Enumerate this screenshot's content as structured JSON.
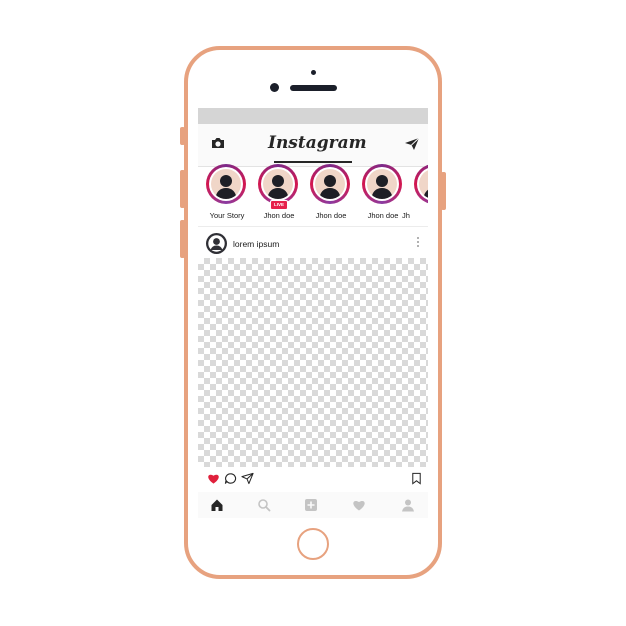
{
  "app": {
    "title": "Instagram"
  },
  "stories": [
    {
      "name": "Your Story",
      "live": false
    },
    {
      "name": "Jhon doe",
      "live": true,
      "badge": "LIVE"
    },
    {
      "name": "Jhon doe",
      "live": false
    },
    {
      "name": "Jhon doe",
      "live": false
    },
    {
      "name": "Jh",
      "live": false
    }
  ],
  "post": {
    "username": "lorem ipsum",
    "liked": true
  },
  "icons": {
    "nav_left": "camera-icon",
    "nav_right": "send-icon",
    "actions": [
      "heart-icon",
      "comment-icon",
      "share-icon",
      "bookmark-icon"
    ],
    "tabs": [
      "home-icon",
      "search-icon",
      "add-icon",
      "activity-icon",
      "profile-icon"
    ]
  },
  "colors": {
    "phone_frame": "#e7a27f",
    "like_red": "#e0203c",
    "story_ring": "#c0245e",
    "live_badge": "#e6224c"
  }
}
